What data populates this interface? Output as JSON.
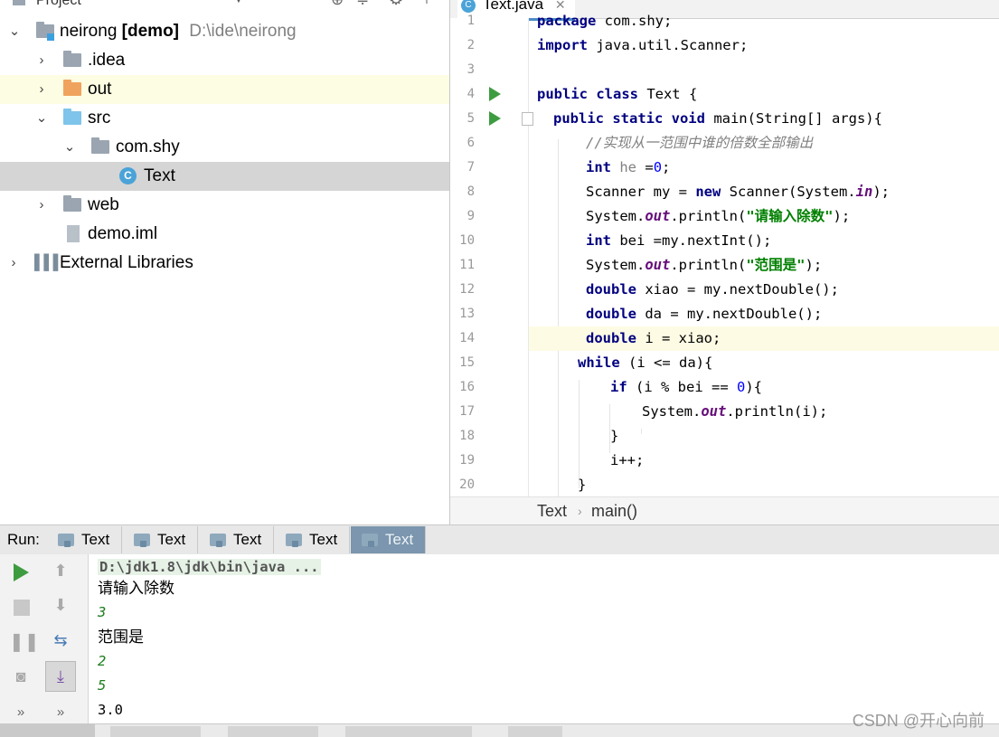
{
  "project_panel": {
    "header_label": "Project",
    "tree": [
      {
        "label": "neirong",
        "module_tag": "[demo]",
        "path": "D:\\ide\\neirong",
        "type": "module",
        "expanded": true
      },
      {
        "label": ".idea",
        "type": "folder-gray",
        "expanded": false
      },
      {
        "label": "out",
        "type": "folder-orange",
        "expanded": false
      },
      {
        "label": "src",
        "type": "folder-blue",
        "expanded": true
      },
      {
        "label": "com.shy",
        "type": "package",
        "expanded": true
      },
      {
        "label": "Text",
        "type": "class",
        "selected": true
      },
      {
        "label": "web",
        "type": "folder-web",
        "expanded": false
      },
      {
        "label": "demo.iml",
        "type": "file"
      },
      {
        "label": "External Libraries",
        "type": "libraries",
        "expanded": false
      }
    ]
  },
  "editor": {
    "tab_label": "Text.java",
    "tab_icon": "C",
    "line_numbers": [
      "1",
      "2",
      "3",
      "4",
      "5",
      "6",
      "7",
      "8",
      "9",
      "10",
      "11",
      "12",
      "13",
      "14",
      "15",
      "16",
      "17",
      "18",
      "19",
      "20"
    ],
    "current_line": "14",
    "breadcrumb": [
      "Text",
      "main()"
    ]
  },
  "run_panel": {
    "label": "Run:",
    "tabs": [
      "Text",
      "Text",
      "Text",
      "Text",
      "Text"
    ],
    "console": {
      "command": "D:\\jdk1.8\\jdk\\bin\\java ...",
      "lines": [
        {
          "text": "请输入除数",
          "kind": "out"
        },
        {
          "text": "3",
          "kind": "in"
        },
        {
          "text": "范围是",
          "kind": "out"
        },
        {
          "text": "2",
          "kind": "in"
        },
        {
          "text": "5",
          "kind": "in"
        },
        {
          "text": "3.0",
          "kind": "mono"
        }
      ]
    }
  },
  "watermark": "CSDN @开心向前",
  "colors": {
    "run_green": "#3e9c40",
    "active_tab": "#7b96ae",
    "keyword": "#000080",
    "string": "#008000"
  }
}
